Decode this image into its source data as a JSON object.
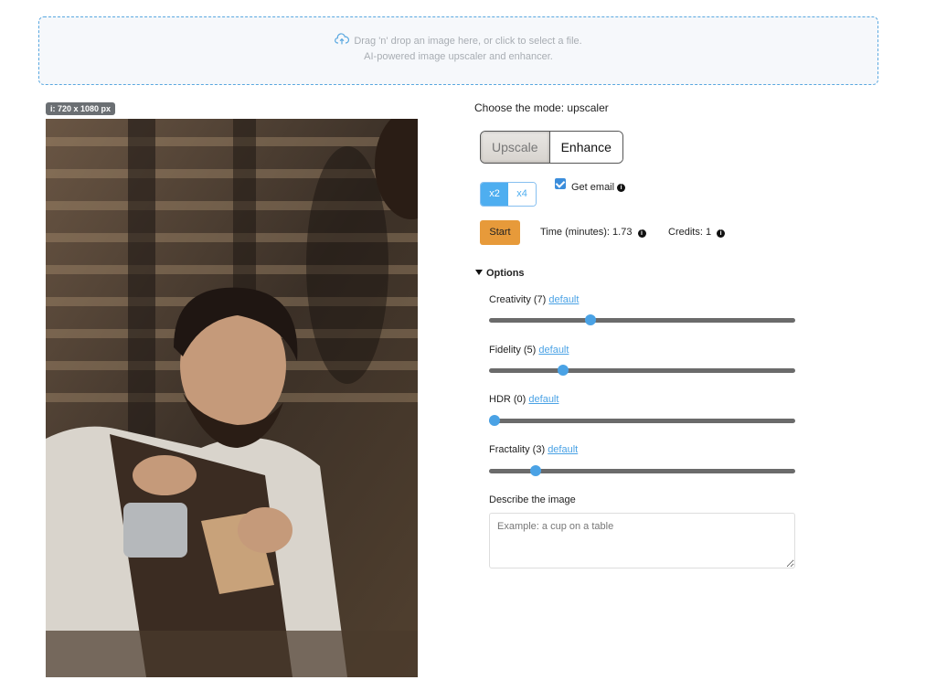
{
  "dropzone": {
    "line1": "Drag 'n' drop an image here, or click to select a file.",
    "line2": "AI-powered image upscaler and enhancer.",
    "icon": "cloud-upload-icon"
  },
  "image": {
    "badge": "i: 720 x 1080 px"
  },
  "mode": {
    "title": "Choose the mode: upscaler",
    "options": [
      "Upscale",
      "Enhance"
    ],
    "selected": "Upscale"
  },
  "scale": {
    "options": [
      "x2",
      "x4"
    ],
    "selected": "x2"
  },
  "email": {
    "label": "Get email",
    "checked": true
  },
  "start": {
    "label": "Start"
  },
  "time": {
    "label": "Time (minutes): 1.73"
  },
  "credits": {
    "label": "Credits: 1"
  },
  "options": {
    "title": "Options",
    "default_link": "default",
    "sliders": [
      {
        "label": "Creativity (7)",
        "value": 7,
        "min": 0,
        "max": 20
      },
      {
        "label": "Fidelity (5)",
        "value": 5,
        "min": 0,
        "max": 20
      },
      {
        "label": "HDR (0)",
        "value": 0,
        "min": 0,
        "max": 20
      },
      {
        "label": "Fractality (3)",
        "value": 3,
        "min": 0,
        "max": 20
      }
    ]
  },
  "describe": {
    "label": "Describe the image",
    "placeholder": "Example: a cup on a table"
  },
  "colors": {
    "accent": "#4aa2e5",
    "start": "#e79a3a",
    "dropzone_border": "#5aa8e0"
  }
}
